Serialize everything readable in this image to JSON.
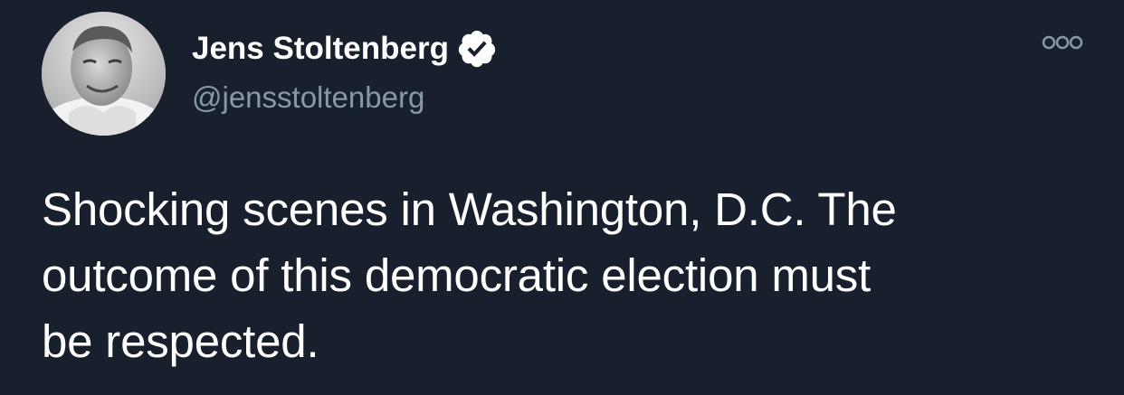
{
  "author": {
    "display_name": "Jens Stoltenberg",
    "handle": "@jensstoltenberg",
    "verified": true,
    "avatar": "profile-photo"
  },
  "tweet": {
    "lines": [
      "Shocking scenes in Washington, D.C. The",
      "outcome of this democratic election must",
      "be respected."
    ]
  },
  "menu": {
    "icon": "more-options-icon"
  },
  "colors": {
    "background": "#18202d",
    "text": "#ffffff",
    "secondary_text": "#8899a6",
    "badge": "#ffffff"
  }
}
